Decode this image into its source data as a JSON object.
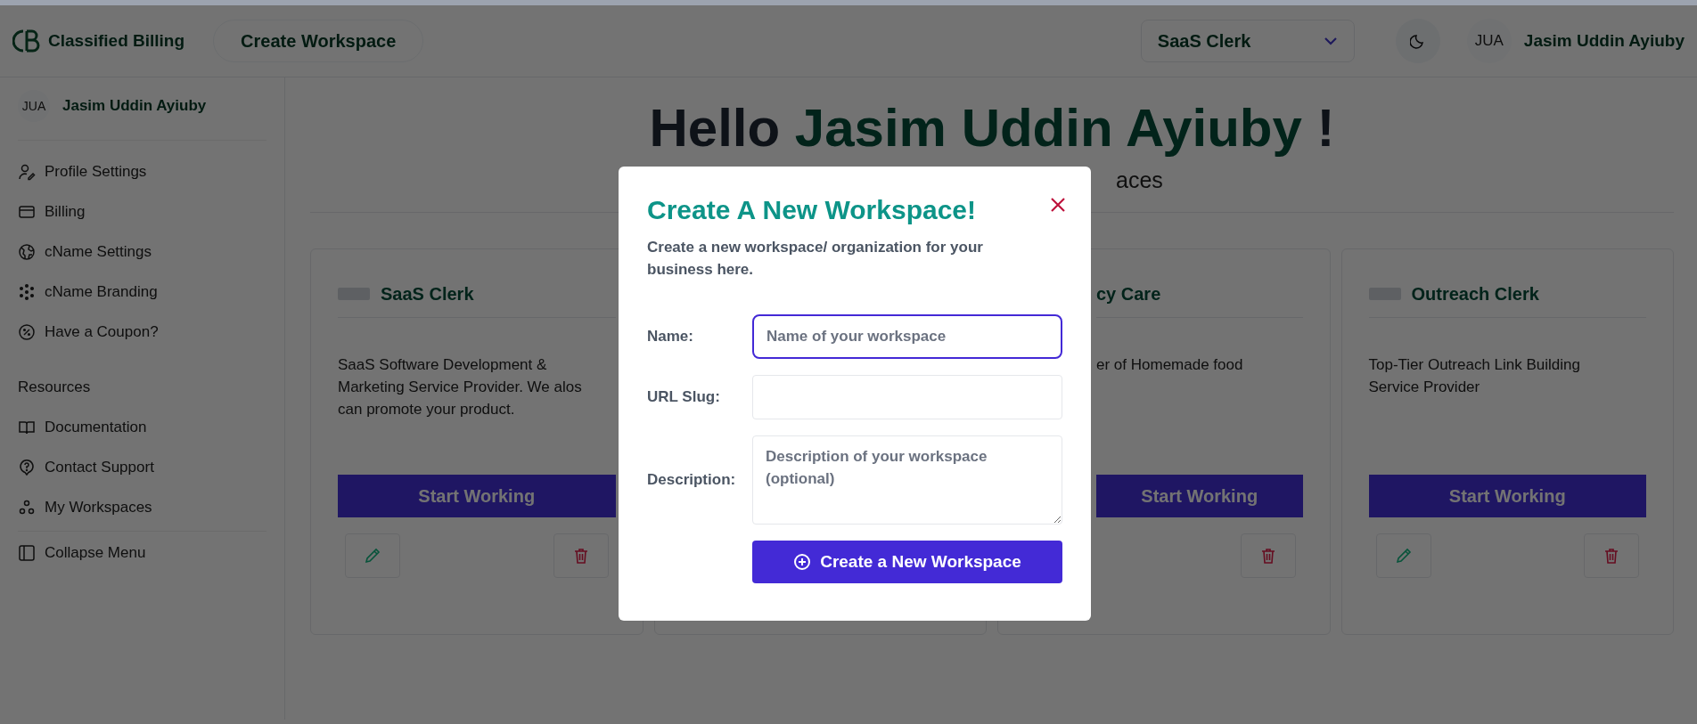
{
  "header": {
    "brand": "Classified Billing",
    "create_button": "Create Workspace",
    "workspace_select": "SaaS Clerk",
    "user": {
      "initials": "JUA",
      "name": "Jasim Uddin Ayiuby"
    }
  },
  "sidebar": {
    "user": {
      "initials": "JUA",
      "name": "Jasim Uddin Ayiuby"
    },
    "items": [
      {
        "kind": "profile",
        "label": "Profile Settings"
      },
      {
        "kind": "billing",
        "label": "Billing"
      },
      {
        "kind": "globe",
        "label": "cName Settings"
      },
      {
        "kind": "branding",
        "label": "cName Branding"
      },
      {
        "kind": "coupon",
        "label": "Have a Coupon?"
      }
    ],
    "resources_heading": "Resources",
    "resources": [
      {
        "kind": "book",
        "label": "Documentation"
      },
      {
        "kind": "help",
        "label": "Contact Support"
      },
      {
        "kind": "workspaces",
        "label": "My Workspaces"
      }
    ],
    "collapse": "Collapse Menu"
  },
  "main": {
    "greeting": "Hello",
    "name": "Jasim Uddin Ayiuby",
    "exclamation": "!",
    "subtitle": "aces",
    "cards": [
      {
        "kind": "full",
        "title": "SaaS Clerk",
        "description": "SaaS Software Development & Marketing Service Provider. We alos can promote your product.",
        "button": "Start Working",
        "edit": true,
        "delete": true
      },
      {
        "kind": "covered"
      },
      {
        "kind": "partial",
        "title": "cy Care",
        "description": "er of Homemade food",
        "button": "Start Working",
        "edit": false,
        "delete": true
      },
      {
        "kind": "full",
        "title": "Outreach Clerk",
        "description": "Top-Tier Outreach Link Building Service Provider",
        "button": "Start Working",
        "edit": true,
        "delete": true
      }
    ]
  },
  "modal": {
    "title": "Create A New Workspace!",
    "description": "Create a new workspace/ organization for your business here.",
    "fields": [
      {
        "kind": "input",
        "label": "Name:",
        "placeholder": "Name of your workspace",
        "focused": true
      },
      {
        "kind": "input",
        "label": "URL Slug:",
        "focused": false
      },
      {
        "kind": "textarea",
        "label": "Description:",
        "placeholder": "Description of your workspace (optional)",
        "focused": false
      }
    ],
    "submit": "Create a New Workspace"
  }
}
